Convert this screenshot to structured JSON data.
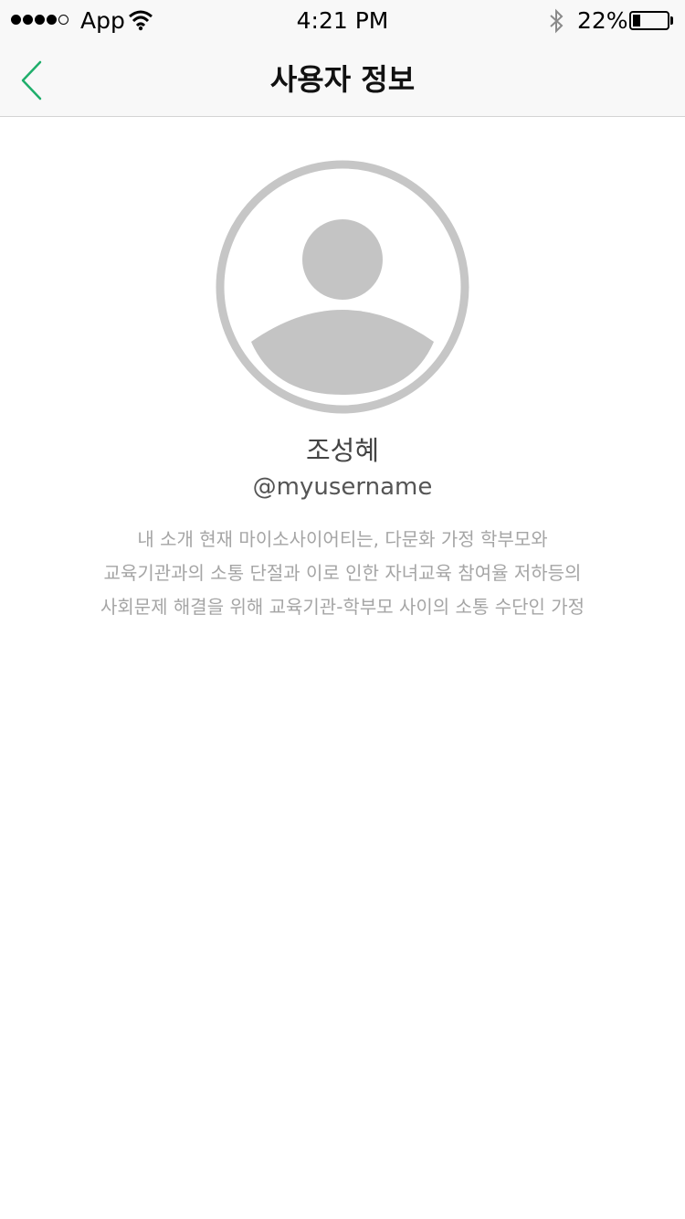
{
  "status_bar": {
    "carrier": "App",
    "time": "4:21 PM",
    "battery_percent": "22%",
    "battery_level": 0.22,
    "signal_bars": 4,
    "signal_total": 5
  },
  "nav": {
    "title": "사용자 정보",
    "back_icon": "chevron-left-icon",
    "accent_color": "#1fae6b"
  },
  "profile": {
    "avatar_icon": "user-placeholder-icon",
    "name": "조성혜",
    "username": "@myusername",
    "bio": "내 소개 현재 마이소사이어티는, 다문화 가정 학부모와 교육기관과의 소통 단절과 이로 인한 자녀교육 참여율 저하등의 사회문제 해결을 위해 교육기관-학부모 사이의 소통 수단인 가정"
  }
}
